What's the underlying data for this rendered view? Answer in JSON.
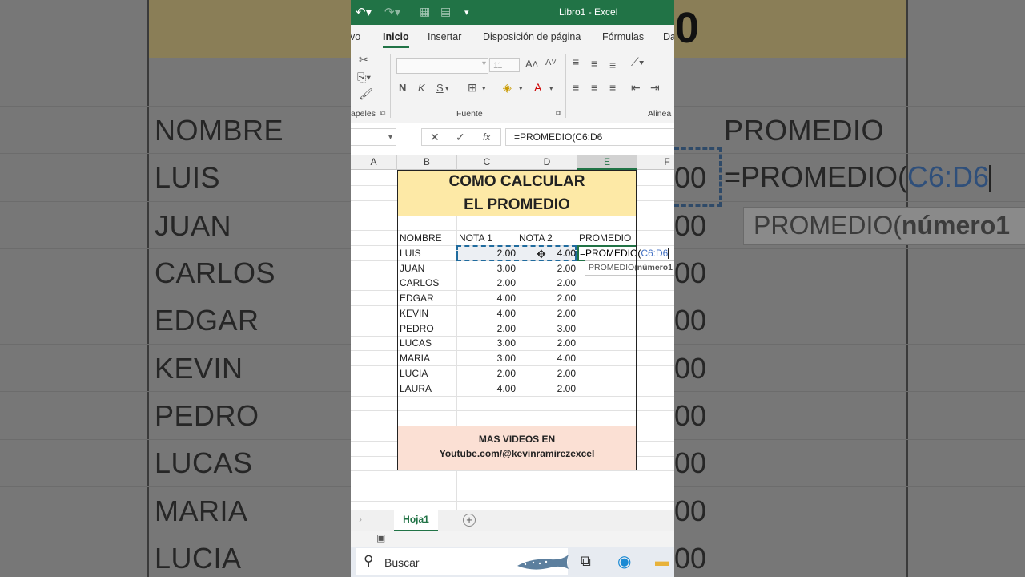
{
  "app": {
    "title": "Libro1  -  Excel",
    "menu_tabs": [
      "vo",
      "Inicio",
      "Insertar",
      "Disposición de página",
      "Fórmulas",
      "Da"
    ],
    "active_tab": "Inicio",
    "ribbon_groups": {
      "clipboard": "apeles",
      "font": "Fuente",
      "alignment": "Alinea"
    },
    "font_size": "11",
    "bold_label": "N",
    "italic_label": "K",
    "underline_label": "S",
    "fx_label": "fx",
    "formula_bar": "=PROMEDIO(C6:D6",
    "columns": [
      "A",
      "B",
      "C",
      "D",
      "E",
      "F"
    ],
    "selected_column": "E"
  },
  "sheet": {
    "title_line1": "COMO CALCULAR",
    "title_line2": "EL PROMEDIO",
    "headers": [
      "NOMBRE",
      "NOTA 1",
      "NOTA 2",
      "PROMEDIO"
    ],
    "rows": [
      {
        "name": "LUIS",
        "nota1": "2.00",
        "nota2": "4.00"
      },
      {
        "name": "JUAN",
        "nota1": "3.00",
        "nota2": "2.00"
      },
      {
        "name": "CARLOS",
        "nota1": "2.00",
        "nota2": "2.00"
      },
      {
        "name": "EDGAR",
        "nota1": "4.00",
        "nota2": "2.00"
      },
      {
        "name": "KEVIN",
        "nota1": "4.00",
        "nota2": "2.00"
      },
      {
        "name": "PEDRO",
        "nota1": "2.00",
        "nota2": "3.00"
      },
      {
        "name": "LUCAS",
        "nota1": "3.00",
        "nota2": "2.00"
      },
      {
        "name": "MARIA",
        "nota1": "3.00",
        "nota2": "4.00"
      },
      {
        "name": "LUCIA",
        "nota1": "2.00",
        "nota2": "2.00"
      },
      {
        "name": "LAURA",
        "nota1": "4.00",
        "nota2": "2.00"
      }
    ],
    "active_cell_prefix": "=PROMEDIO(",
    "active_cell_ref": "C6:D6",
    "tooltip_prefix": "PROMEDIO(",
    "tooltip_arg": "número1",
    "footer_line1": "MAS VIDEOS EN",
    "footer_line2": "Youtube.com/@kevinramirezexcel"
  },
  "sheet_tab": "Hoja1",
  "taskbar": {
    "search_label": "Buscar"
  },
  "background_zoom": {
    "names": [
      "NOMBRE",
      "LUIS",
      "JUAN",
      "CARLOS",
      "EDGAR",
      "KEVIN",
      "PEDRO",
      "LUCAS",
      "MARIA",
      "LUCIA"
    ],
    "header": "PROMEDIO",
    "formula_prefix": "=PROMEDIO(",
    "formula_ref": "C6:D6",
    "tooltip_prefix": "PROMEDIO(",
    "tooltip_arg": "número1",
    "number_tail": "00",
    "top_fragment": "0"
  },
  "colors": {
    "excel_green": "#217346",
    "title_fill": "#fde9a6",
    "footer_fill": "#fbe0d4",
    "ref_blue": "#4472c4"
  }
}
